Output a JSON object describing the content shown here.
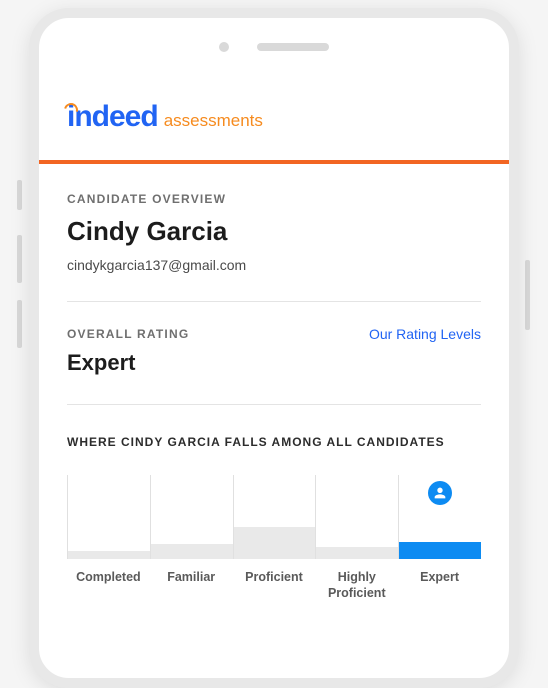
{
  "brand": {
    "main": "indeed",
    "sub": "assessments"
  },
  "overview": {
    "label": "CANDIDATE OVERVIEW",
    "name": "Cindy Garcia",
    "email": "cindykgarcia137@gmail.com"
  },
  "rating": {
    "label": "OVERALL RATING",
    "value": "Expert",
    "link": "Our Rating Levels"
  },
  "distribution": {
    "title": "WHERE CINDY GARCIA FALLS AMONG ALL CANDIDATES",
    "levels": [
      "Completed",
      "Familiar",
      "Proficient",
      "Highly Proficient",
      "Expert"
    ]
  },
  "chart_data": {
    "type": "bar",
    "categories": [
      "Completed",
      "Familiar",
      "Proficient",
      "Highly Proficient",
      "Expert"
    ],
    "values": [
      10,
      18,
      38,
      14,
      20
    ],
    "highlighted_index": 4,
    "title": "WHERE CINDY GARCIA FALLS AMONG ALL CANDIDATES",
    "xlabel": "",
    "ylabel": "",
    "ylim": [
      0,
      100
    ]
  },
  "colors": {
    "brand_blue": "#2164f3",
    "brand_orange": "#f68b1f",
    "accent_orange": "#f26522",
    "chart_blue": "#0d8bf2",
    "chart_gray": "#e9e9e9"
  }
}
